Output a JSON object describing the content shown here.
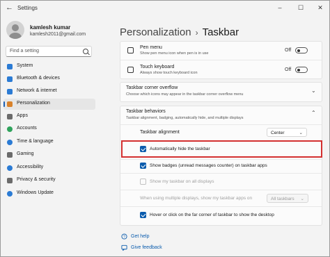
{
  "window": {
    "title": "Settings"
  },
  "user": {
    "name": "kamlesh kumar",
    "email": "kamlesh2011@gmail.com"
  },
  "search": {
    "placeholder": "Find a setting"
  },
  "sidebar": {
    "items": [
      {
        "label": "System",
        "icon": "monitor-icon",
        "color": "#2b7bd4"
      },
      {
        "label": "Bluetooth & devices",
        "icon": "bluetooth-icon",
        "color": "#2b7bd4"
      },
      {
        "label": "Network & internet",
        "icon": "network-icon",
        "color": "#2b7bd4"
      },
      {
        "label": "Personalization",
        "icon": "brush-icon",
        "color": "#d9822b",
        "active": true
      },
      {
        "label": "Apps",
        "icon": "apps-icon",
        "color": "#6b6b6b"
      },
      {
        "label": "Accounts",
        "icon": "person-icon",
        "color": "#2fa35c"
      },
      {
        "label": "Time & language",
        "icon": "globe-clock-icon",
        "color": "#2b7bd4"
      },
      {
        "label": "Gaming",
        "icon": "gamepad-icon",
        "color": "#6b6b6b"
      },
      {
        "label": "Accessibility",
        "icon": "accessibility-icon",
        "color": "#2b7bd4"
      },
      {
        "label": "Privacy & security",
        "icon": "shield-icon",
        "color": "#6b6b6b"
      },
      {
        "label": "Windows Update",
        "icon": "update-icon",
        "color": "#2b7bd4"
      }
    ]
  },
  "header": {
    "parent": "Personalization",
    "separator": "›",
    "title": "Taskbar"
  },
  "icons_section": {
    "pen": {
      "title": "Pen menu",
      "sub": "Show pen menu icon when pen is in use",
      "state": "Off"
    },
    "touch": {
      "title": "Touch keyboard",
      "sub": "Always show touch keyboard icon",
      "state": "Off"
    }
  },
  "overflow": {
    "title": "Taskbar corner overflow",
    "sub": "Choose which icons may appear in the taskbar corner overflow menu"
  },
  "behaviors": {
    "title": "Taskbar behaviors",
    "sub": "Taskbar alignment, badging, automatically hide, and multiple displays",
    "alignment_label": "Taskbar alignment",
    "alignment_value": "Center",
    "options": [
      {
        "label": "Automatically hide the taskbar",
        "checked": true,
        "disabled": false
      },
      {
        "label": "Show badges (unread messages counter) on taskbar apps",
        "checked": true,
        "disabled": false
      },
      {
        "label": "Show my taskbar on all displays",
        "checked": false,
        "disabled": true
      },
      {
        "label": "When using multiple displays, show my taskbar apps on",
        "checked": false,
        "disabled": true
      },
      {
        "label": "Hover or click on the far corner of taskbar to show the desktop",
        "checked": true,
        "disabled": false
      }
    ],
    "multi_display_value": "All taskbars"
  },
  "links": {
    "help": "Get help",
    "feedback": "Give feedback"
  }
}
